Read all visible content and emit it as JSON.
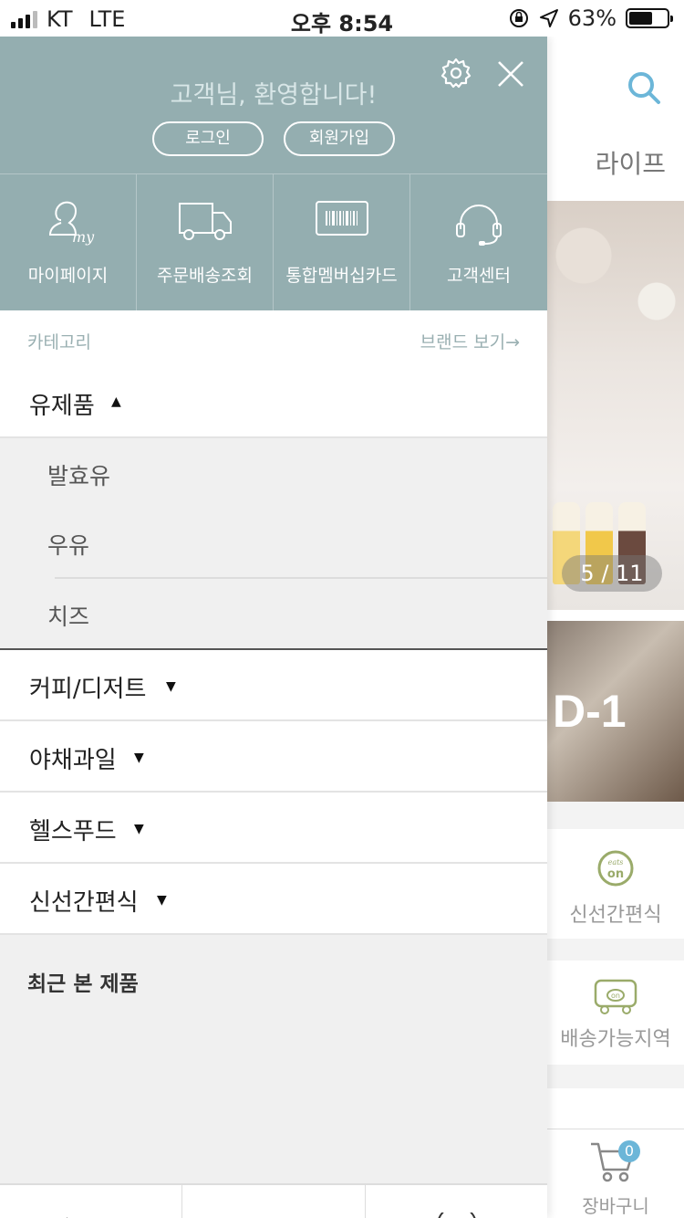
{
  "status_bar": {
    "carrier": "KT",
    "network": "LTE",
    "time": "오후 8:54",
    "battery_percent": "63%",
    "battery_level": 0.63
  },
  "background_page": {
    "header_title": "라이프",
    "banner_counter": "5 / 11",
    "banner2_text": "D-1",
    "tile1_logo": "eats on",
    "tile1_label": "신선간편식",
    "tile2_label": "배송가능지역",
    "cart_count": "0",
    "cart_label": "장바구니"
  },
  "drawer": {
    "welcome": "고객님, 환영합니다!",
    "login_label": "로그인",
    "signup_label": "회원가입",
    "quick_links": [
      {
        "label": "마이페이지",
        "icon": "mypage-icon"
      },
      {
        "label": "주문배송조회",
        "icon": "truck-icon"
      },
      {
        "label": "통합멤버십카드",
        "icon": "barcode-card-icon"
      },
      {
        "label": "고객센터",
        "icon": "headset-icon"
      }
    ],
    "category_label": "카테고리",
    "brand_link": "브랜드 보기→",
    "categories": [
      {
        "label": "유제품",
        "expanded": true,
        "children": [
          "발효유",
          "우유",
          "치즈"
        ]
      },
      {
        "label": "커피/디저트",
        "expanded": false
      },
      {
        "label": "야채과일",
        "expanded": false
      },
      {
        "label": "헬스푸드",
        "expanded": false
      },
      {
        "label": "신선간편식",
        "expanded": false
      }
    ],
    "recent_label": "최근 본 제품",
    "arrow_up": "▲",
    "arrow_down": "▼"
  },
  "colors": {
    "drawer_header": "#94aeb0",
    "accent_blue": "#6cb6d8"
  }
}
